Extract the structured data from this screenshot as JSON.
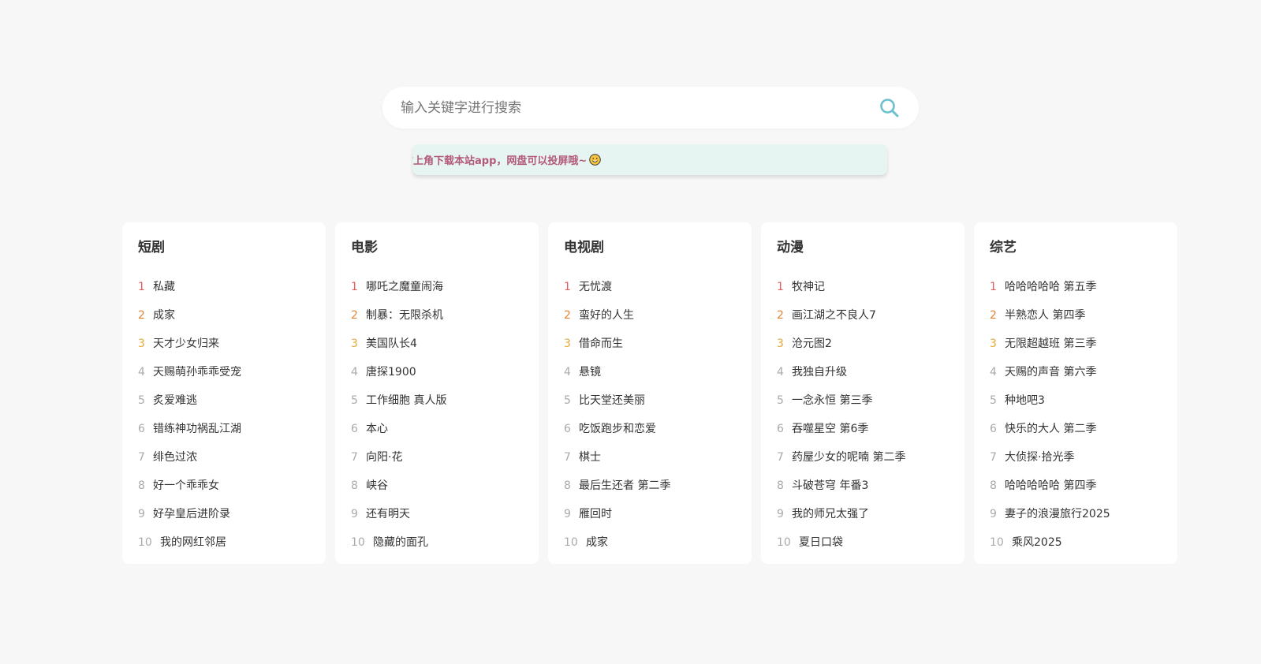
{
  "search": {
    "placeholder": "输入关键字进行搜索",
    "icon": "search-icon"
  },
  "notice": {
    "text": "右上角下载本站app，网盘可以投屏哦~",
    "emoji": "smiley-icon"
  },
  "colors": {
    "rank1": "#e25c5c",
    "rank2": "#e58434",
    "rank3": "#e6a93a",
    "rank_other": "#aaaaaa",
    "accent_search": "#6cc1cd",
    "notice_bg": "#e6f5f1",
    "notice_text": "#b4587a"
  },
  "categories": [
    {
      "title": "短剧",
      "items": [
        {
          "rank": "1",
          "title": "私藏"
        },
        {
          "rank": "2",
          "title": "成家"
        },
        {
          "rank": "3",
          "title": "天才少女归来"
        },
        {
          "rank": "4",
          "title": "天赐萌孙乖乖受宠"
        },
        {
          "rank": "5",
          "title": "炙爱难逃"
        },
        {
          "rank": "6",
          "title": "错练神功祸乱江湖"
        },
        {
          "rank": "7",
          "title": "绯色过浓"
        },
        {
          "rank": "8",
          "title": "好一个乖乖女"
        },
        {
          "rank": "9",
          "title": "好孕皇后进阶录"
        },
        {
          "rank": "10",
          "title": "我的网红邻居"
        }
      ]
    },
    {
      "title": "电影",
      "items": [
        {
          "rank": "1",
          "title": "哪吒之魔童闹海"
        },
        {
          "rank": "2",
          "title": "制暴：无限杀机"
        },
        {
          "rank": "3",
          "title": "美国队长4"
        },
        {
          "rank": "4",
          "title": "唐探1900"
        },
        {
          "rank": "5",
          "title": "工作细胞 真人版"
        },
        {
          "rank": "6",
          "title": "本心"
        },
        {
          "rank": "7",
          "title": "向阳·花"
        },
        {
          "rank": "8",
          "title": "峡谷"
        },
        {
          "rank": "9",
          "title": "还有明天"
        },
        {
          "rank": "10",
          "title": "隐藏的面孔"
        }
      ]
    },
    {
      "title": "电视剧",
      "items": [
        {
          "rank": "1",
          "title": "无忧渡"
        },
        {
          "rank": "2",
          "title": "蛮好的人生"
        },
        {
          "rank": "3",
          "title": "借命而生"
        },
        {
          "rank": "4",
          "title": "悬镜"
        },
        {
          "rank": "5",
          "title": "比天堂还美丽"
        },
        {
          "rank": "6",
          "title": "吃饭跑步和恋爱"
        },
        {
          "rank": "7",
          "title": "棋士"
        },
        {
          "rank": "8",
          "title": "最后生还者 第二季"
        },
        {
          "rank": "9",
          "title": "雁回时"
        },
        {
          "rank": "10",
          "title": "成家"
        }
      ]
    },
    {
      "title": "动漫",
      "items": [
        {
          "rank": "1",
          "title": "牧神记"
        },
        {
          "rank": "2",
          "title": "画江湖之不良人7"
        },
        {
          "rank": "3",
          "title": "沧元图2"
        },
        {
          "rank": "4",
          "title": "我独自升级"
        },
        {
          "rank": "5",
          "title": "一念永恒 第三季"
        },
        {
          "rank": "6",
          "title": "吞噬星空 第6季"
        },
        {
          "rank": "7",
          "title": "药屋少女的呢喃 第二季"
        },
        {
          "rank": "8",
          "title": "斗破苍穹 年番3"
        },
        {
          "rank": "9",
          "title": "我的师兄太强了"
        },
        {
          "rank": "10",
          "title": "夏日口袋"
        }
      ]
    },
    {
      "title": "综艺",
      "items": [
        {
          "rank": "1",
          "title": "哈哈哈哈哈 第五季"
        },
        {
          "rank": "2",
          "title": "半熟恋人 第四季"
        },
        {
          "rank": "3",
          "title": "无限超越班 第三季"
        },
        {
          "rank": "4",
          "title": "天赐的声音 第六季"
        },
        {
          "rank": "5",
          "title": "种地吧3"
        },
        {
          "rank": "6",
          "title": "快乐的大人 第二季"
        },
        {
          "rank": "7",
          "title": "大侦探·拾光季"
        },
        {
          "rank": "8",
          "title": "哈哈哈哈哈 第四季"
        },
        {
          "rank": "9",
          "title": "妻子的浪漫旅行2025"
        },
        {
          "rank": "10",
          "title": "乘风2025"
        }
      ]
    }
  ]
}
